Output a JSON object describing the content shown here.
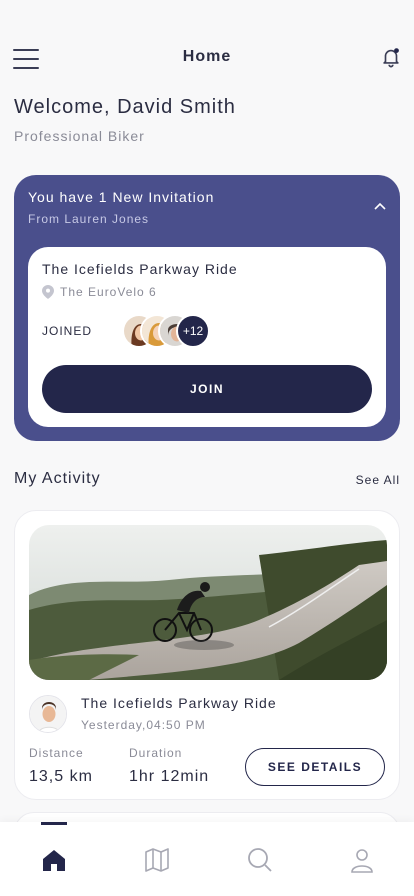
{
  "header": {
    "title": "Home"
  },
  "welcome": {
    "greeting": "Welcome, David Smith",
    "role": "Professional Biker"
  },
  "invitation": {
    "title": "You have 1 New Invitation",
    "from": "From Lauren Jones",
    "ride": {
      "name": "The Icefields Parkway Ride",
      "location": "The EuroVelo 6",
      "joined_label": "JOINED",
      "more_count": "+12",
      "join_label": "JOIN"
    }
  },
  "activity": {
    "section_title": "My Activity",
    "see_all": "See All",
    "card": {
      "name": "The Icefields Parkway Ride",
      "time": "Yesterday,04:50 PM",
      "distance_label": "Distance",
      "distance_value": "13,5 km",
      "duration_label": "Duration",
      "duration_value": "1hr 12min",
      "details_label": "SEE DETAILS"
    }
  },
  "tabs": [
    "home-icon",
    "map-icon",
    "search-icon",
    "profile-icon"
  ],
  "colors": {
    "accent": "#23264a",
    "card": "#4a4f8c"
  }
}
